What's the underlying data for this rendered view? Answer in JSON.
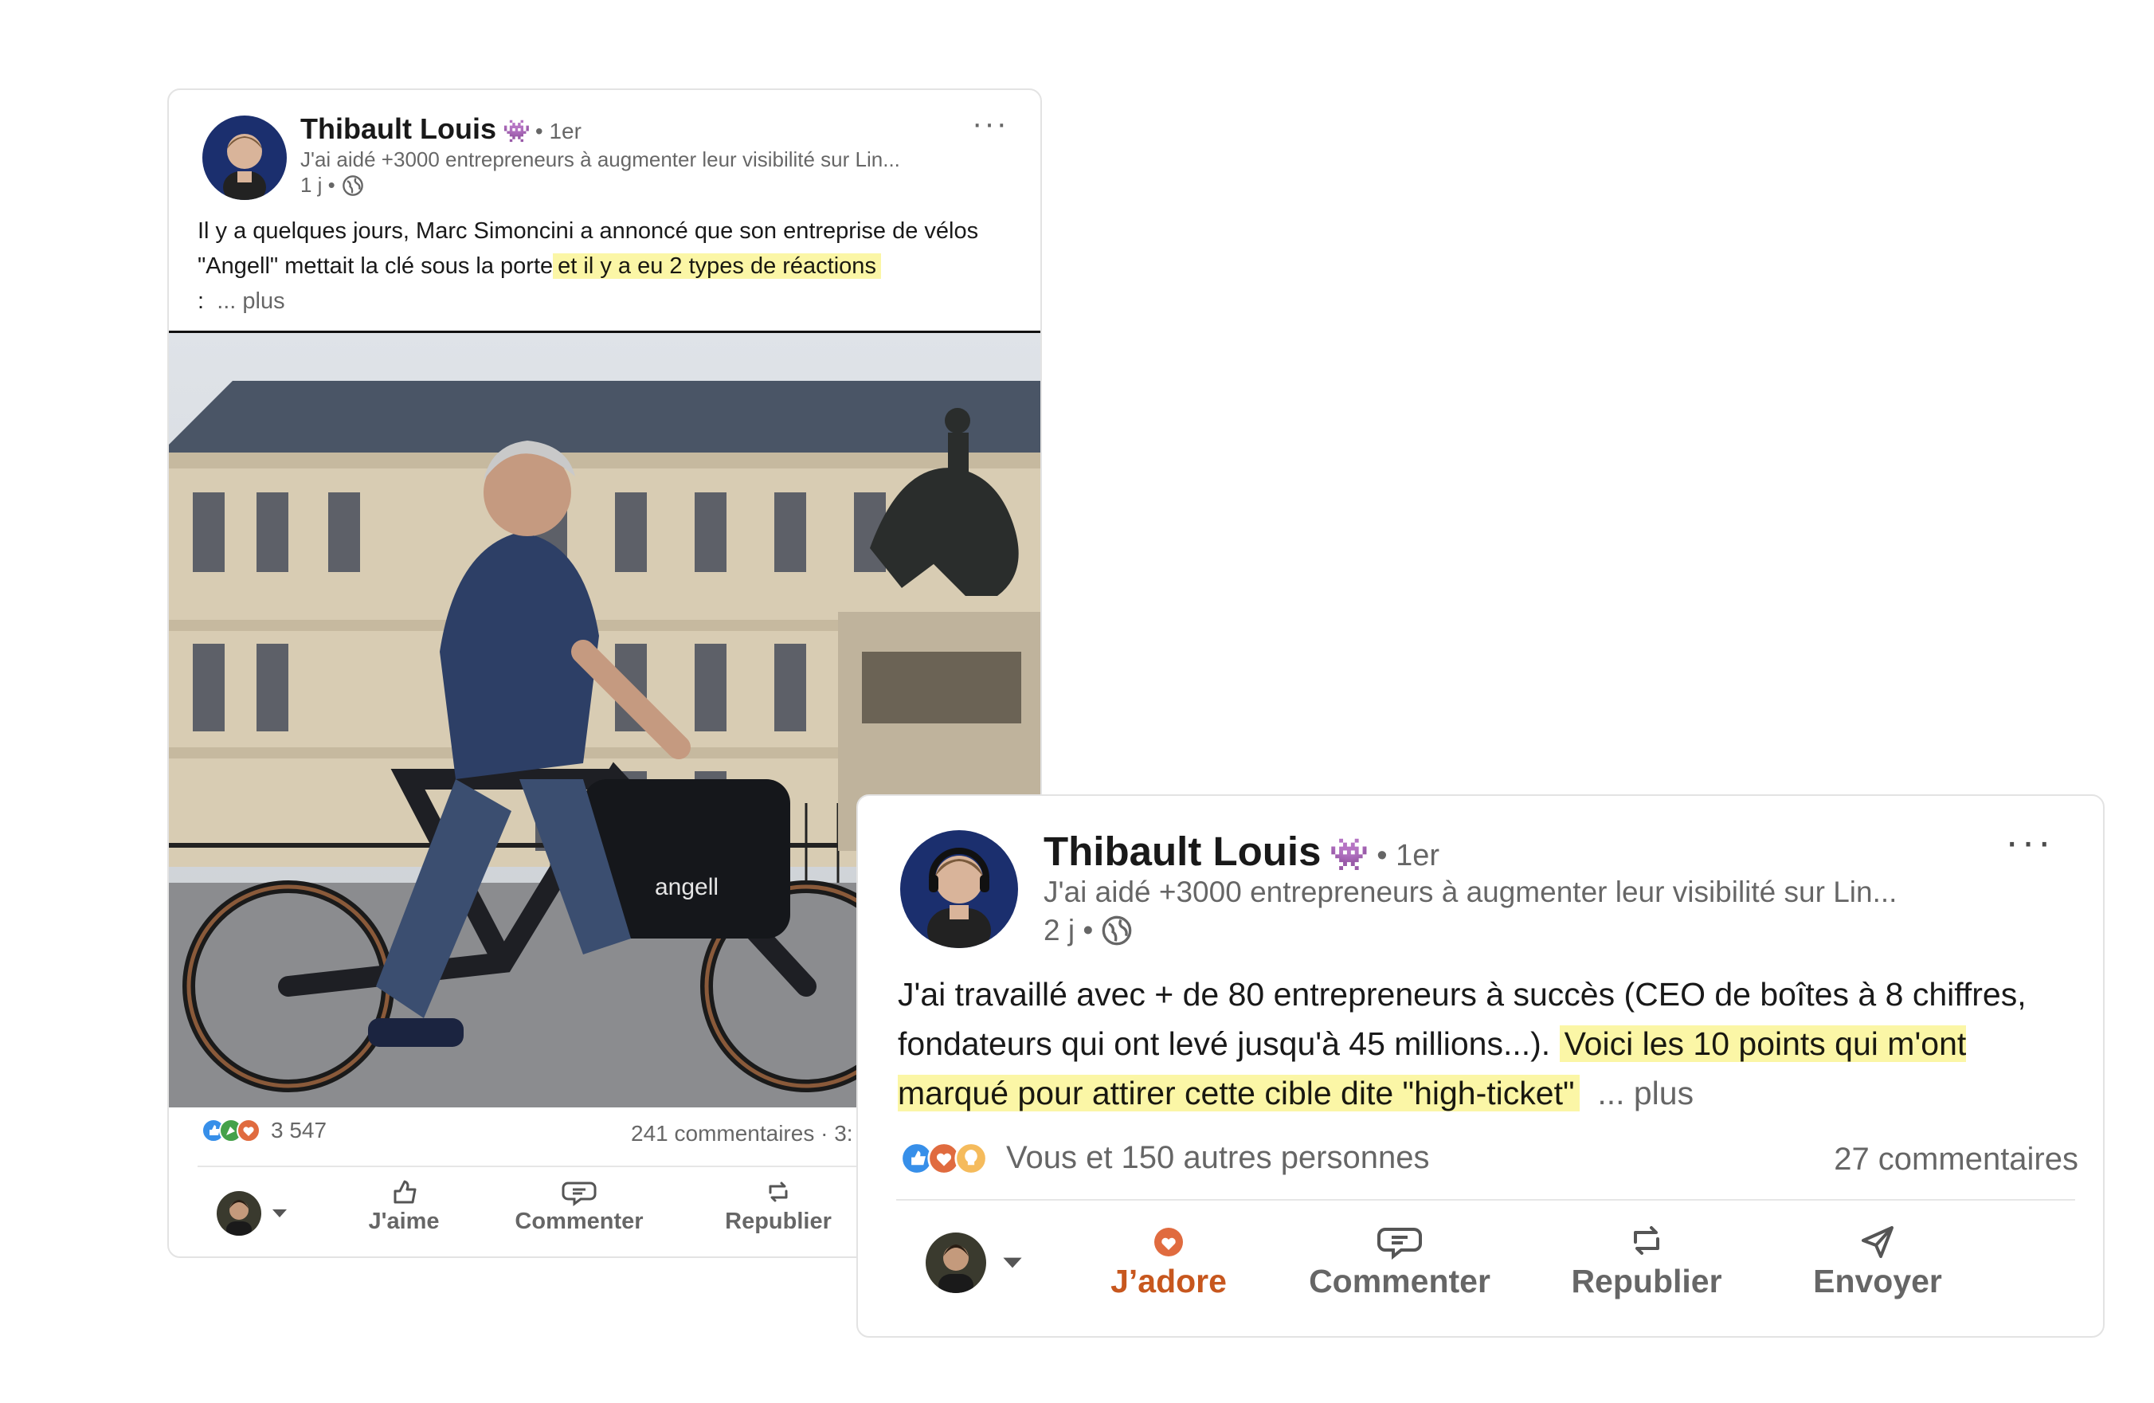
{
  "post1": {
    "author_name": "Thibault Louis",
    "badge_icon": "alien-monster-icon",
    "degree": "• 1er",
    "headline": "J'ai aidé +3000 entrepreneurs à augmenter leur visibilité sur Lin...",
    "time": "1 j •",
    "more": "···",
    "text_plain": "Il y a quelques jours, Marc Simoncini a annoncé que son entreprise de vélos \"Angell\" mettait la clé sous la porte",
    "text_highlight": "et il y a eu 2 types de réactions",
    "text_tail": ":",
    "see_more": "... plus",
    "image_text": "angell",
    "reaction_count": "3 547",
    "comments": "241 commentaires · 3:",
    "actions": {
      "like": "J'aime",
      "comment": "Commenter",
      "repost": "Republier"
    }
  },
  "post2": {
    "author_name": "Thibault Louis",
    "badge_icon": "alien-monster-icon",
    "degree": "• 1er",
    "headline": "J'ai aidé +3000 entrepreneurs à augmenter leur visibilité sur Lin...",
    "time": "2 j •",
    "more": "···",
    "text_plain": "J'ai travaillé avec + de 80 entrepreneurs à succès (CEO de boîtes à 8 chiffres, fondateurs qui ont levé jusqu'à 45 millions...).",
    "text_highlight": "Voici les 10 points qui m'ont marqué pour attirer cette cible dite \"high-ticket\"",
    "see_more": "... plus",
    "reactions_text": "Vous et 150 autres personnes",
    "comments": "27 commentaires",
    "actions": {
      "love": "J’adore",
      "comment": "Commenter",
      "repost": "Republier",
      "send": "Envoyer"
    }
  },
  "colors": {
    "highlight": "#fbf6a6",
    "active_reaction": "#c7571e",
    "muted_text": "#666666"
  }
}
